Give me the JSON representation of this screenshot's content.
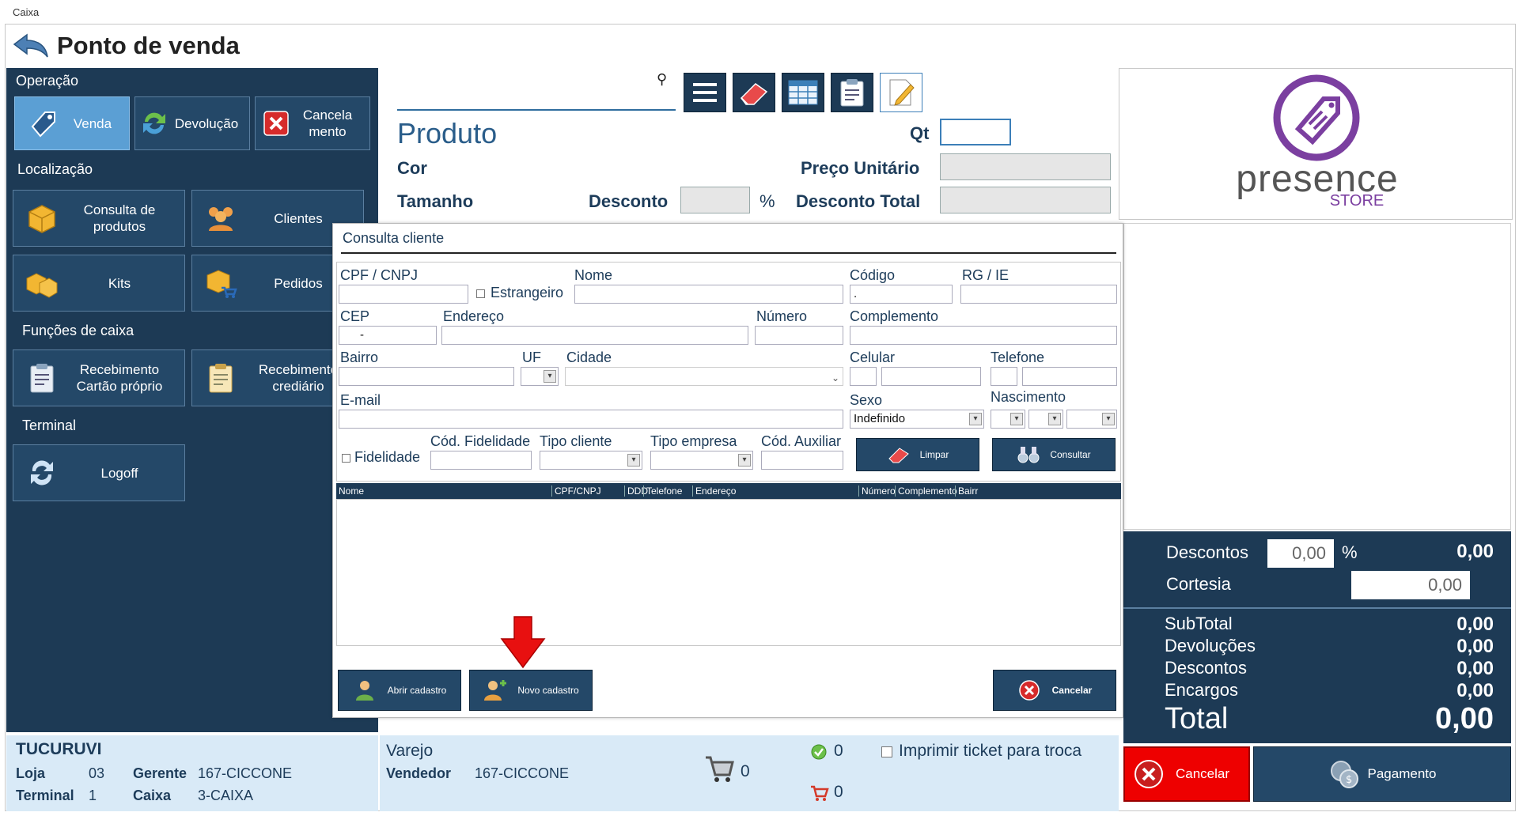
{
  "window": {
    "title": "Caixa"
  },
  "header": {
    "title": "Ponto de venda"
  },
  "operacao": {
    "title": "Operação",
    "venda": "Venda",
    "devolucao": "Devolução",
    "cancelamento": "Cancela\nmento"
  },
  "localizacao": {
    "title": "Localização",
    "consulta_produtos": "Consulta de produtos",
    "clientes": "Clientes",
    "kits": "Kits",
    "pedidos": "Pedidos"
  },
  "funcoes": {
    "title": "Funções de caixa",
    "recebimento_cartao": "Recebimento Cartão próprio",
    "recebimento_crediario": "Recebimento crediário"
  },
  "terminal": {
    "title": "Terminal",
    "logoff": "Logoff"
  },
  "produto": {
    "search_value": "",
    "produto_label": "Produto",
    "qt_label": "Qt",
    "cor_label": "Cor",
    "preco_label": "Preço Unitário",
    "tamanho_label": "Tamanho",
    "desconto_label": "Desconto",
    "percent": "%",
    "desconto_total_label": "Desconto Total"
  },
  "logo": {
    "brand": "presence",
    "sub": "STORE"
  },
  "totals": {
    "descontos_label": "Descontos",
    "descontos_input": "0,00",
    "percent": "%",
    "descontos_value": "0,00",
    "cortesia_label": "Cortesia",
    "cortesia_input": "0,00",
    "subtotal_label": "SubTotal",
    "subtotal_value": "0,00",
    "devolucoes_label": "Devoluções",
    "devolucoes_value": "0,00",
    "descontos2_label": "Descontos",
    "descontos2_value": "0,00",
    "encargos_label": "Encargos",
    "encargos_value": "0,00",
    "total_label": "Total",
    "total_value": "0,00"
  },
  "actions": {
    "cancelar": "Cancelar",
    "pagamento": "Pagamento"
  },
  "store": {
    "name": "TUCURUVI",
    "loja_label": "Loja",
    "loja": "03",
    "gerente_label": "Gerente",
    "gerente": "167-CICCONE",
    "terminal_label": "Terminal",
    "terminal": "1",
    "caixa_label": "Caixa",
    "caixa": "3-CAIXA"
  },
  "sale": {
    "tipo": "Varejo",
    "vendedor_label": "Vendedor",
    "vendedor": "167-CICCONE",
    "cart_count": "0",
    "ok_count": "0",
    "cart2_count": "0",
    "ticket_label": "Imprimir ticket para troca"
  },
  "modal": {
    "title": "Consulta cliente",
    "cpf_label": "CPF / CNPJ",
    "estrangeiro_label": "Estrangeiro",
    "nome_label": "Nome",
    "codigo_label": "Código",
    "codigo_value": ".",
    "rg_label": "RG / IE",
    "cep_label": "CEP",
    "cep_value": "-",
    "endereco_label": "Endereço",
    "numero_label": "Número",
    "complemento_label": "Complemento",
    "bairro_label": "Bairro",
    "uf_label": "UF",
    "cidade_label": "Cidade",
    "celular_label": "Celular",
    "telefone_label": "Telefone",
    "email_label": "E-mail",
    "sexo_label": "Sexo",
    "sexo_value": "Indefinido",
    "nascimento_label": "Nascimento",
    "fidelidade_label": "Fidelidade",
    "cod_fidelidade_label": "Cód. Fidelidade",
    "tipo_cliente_label": "Tipo cliente",
    "tipo_empresa_label": "Tipo empresa",
    "cod_auxiliar_label": "Cód. Auxiliar",
    "limpar": "Limpar",
    "consultar": "Consultar",
    "columns": [
      "Nome",
      "CPF/CNPJ",
      "DDD",
      "Telefone",
      "Endereço",
      "Número",
      "Complemento",
      "Bairr"
    ],
    "abrir_cadastro": "Abrir cadastro",
    "novo_cadastro": "Novo cadastro",
    "cancelar": "Cancelar"
  },
  "colors": {
    "navy": "#1d3a55",
    "accent": "#5b9fd4",
    "red": "#e00000",
    "light": "#d9eaf7"
  }
}
